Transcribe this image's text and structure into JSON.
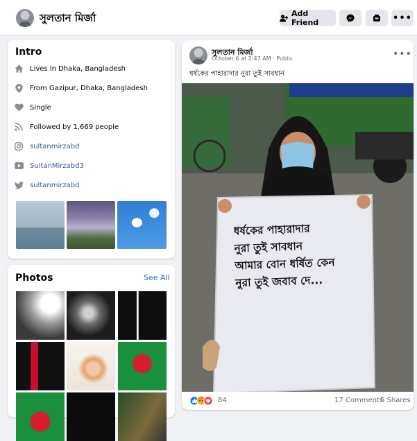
{
  "header": {
    "profile_name": "সুলতান মির্জা",
    "add_friend_label": "Add Friend"
  },
  "intro": {
    "title": "Intro",
    "items": [
      {
        "icon": "home-icon",
        "prefix": "Lives in ",
        "value": "Dhaka, Bangladesh"
      },
      {
        "icon": "location-pin-icon",
        "prefix": "From ",
        "value": "Gazipur, Dhaka, Bangladesh"
      },
      {
        "icon": "heart-icon",
        "prefix": "",
        "value": "Single"
      },
      {
        "icon": "rss-icon",
        "prefix": "Followed by ",
        "value": "1,669 people"
      },
      {
        "icon": "instagram-icon",
        "prefix": "",
        "value": "sultanmirzabd"
      },
      {
        "icon": "youtube-icon",
        "prefix": "",
        "value": "SultanMirzabd3"
      },
      {
        "icon": "twitter-icon",
        "prefix": "",
        "value": "sultanmirzabd"
      }
    ]
  },
  "photos": {
    "title": "Photos",
    "see_all": "See All"
  },
  "post": {
    "author": "সুলতান মির্জা",
    "meta": "October 6 at 2:47 AM · Public",
    "text": "ধর্ষকের পাহারাদার নুরা তুই সাবধান",
    "poster_lines": [
      "ধর্ষকের পাহারাদার",
      "নুরা তুই সাবধান",
      "আমার বোন ধর্ষিত কেন",
      "নুরা তুই জবাব দে..."
    ],
    "reaction_count": "84",
    "comments": "17 Comments",
    "shares": "5 Shares"
  },
  "colors": {
    "accent": "#216fdb",
    "link": "#385898",
    "button_bg": "#e4e6eb",
    "page_bg": "#f0f2f5"
  }
}
